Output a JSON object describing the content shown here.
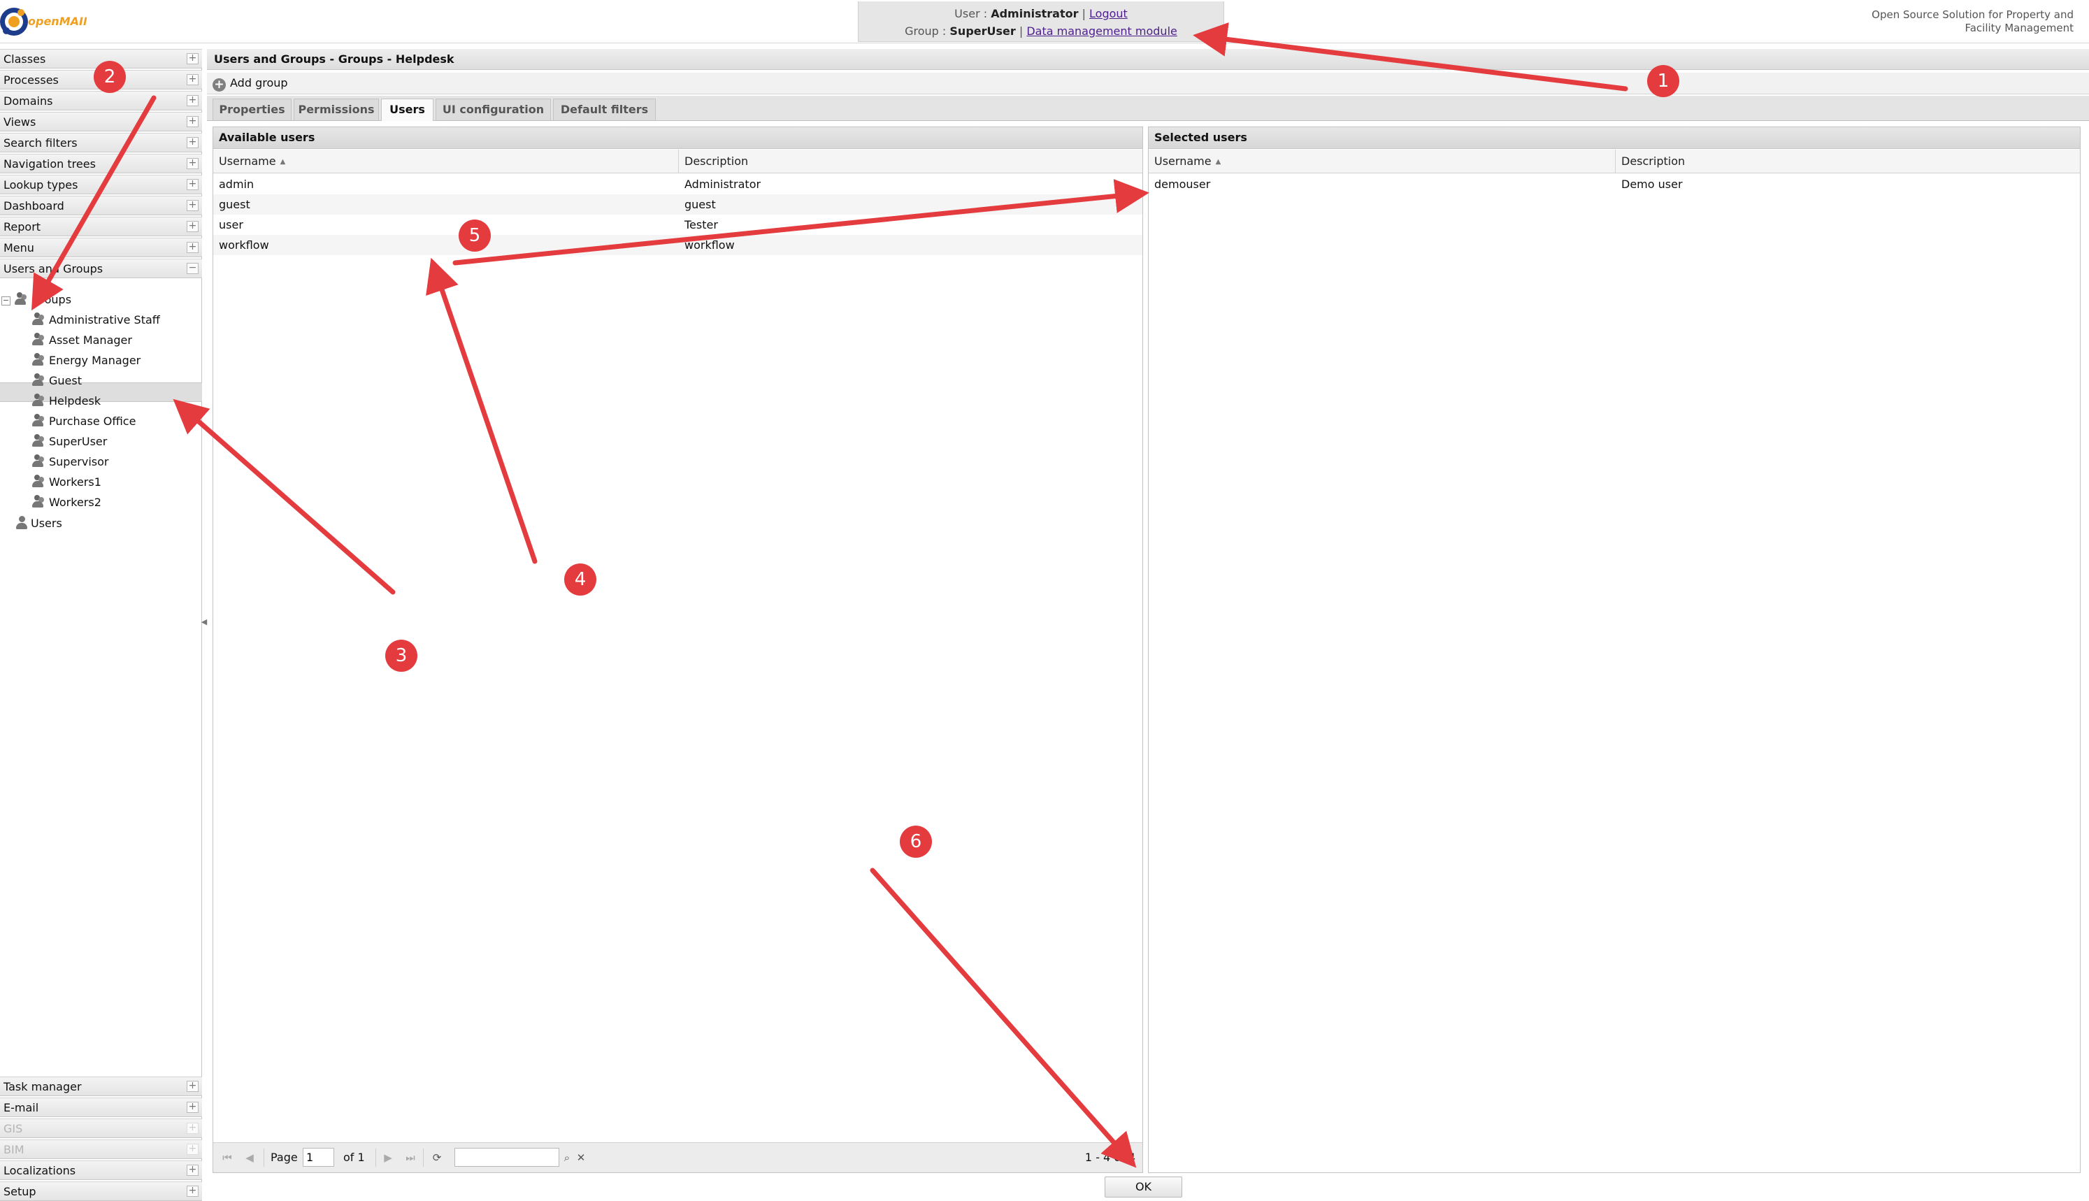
{
  "header": {
    "logo_text": "openMAINT",
    "user_label": "User :",
    "user_name": "Administrator",
    "logout": "Logout",
    "group_label": "Group :",
    "group_name": "SuperUser",
    "data_module": "Data management module",
    "tagline_1": "Open Source Solution for Property and",
    "tagline_2": "Facility Management"
  },
  "sidebar": {
    "top_sections": [
      "Classes",
      "Processes",
      "Domains",
      "Views",
      "Search filters",
      "Navigation trees",
      "Lookup types",
      "Dashboard",
      "Report",
      "Menu"
    ],
    "users_groups": "Users and Groups",
    "tree_groups": "Groups",
    "groups": [
      "Administrative Staff",
      "Asset Manager",
      "Energy Manager",
      "Guest",
      "Helpdesk",
      "Purchase Office",
      "SuperUser",
      "Supervisor",
      "Workers1",
      "Workers2"
    ],
    "tree_users": "Users",
    "bottom_sections": [
      "Task manager",
      "E-mail",
      "GIS",
      "BIM",
      "Localizations",
      "Setup"
    ]
  },
  "main": {
    "breadcrumb": "Users and Groups - Groups - Helpdesk",
    "add_group": "Add group",
    "tabs": [
      "Properties",
      "Permissions",
      "Users",
      "UI configuration",
      "Default filters"
    ],
    "active_tab": "Users"
  },
  "available": {
    "title": "Available users",
    "col_username": "Username",
    "col_description": "Description",
    "rows": [
      {
        "username": "admin",
        "description": "Administrator"
      },
      {
        "username": "guest",
        "description": "guest"
      },
      {
        "username": "user",
        "description": "Tester"
      },
      {
        "username": "workflow",
        "description": "workflow"
      }
    ]
  },
  "selected": {
    "title": "Selected users",
    "col_username": "Username",
    "col_description": "Description",
    "rows": [
      {
        "username": "demouser",
        "description": "Demo user"
      }
    ]
  },
  "pager": {
    "page_label": "Page",
    "page_value": "1",
    "of_label": "of 1",
    "display": "1 - 4 of 4"
  },
  "ok_label": "OK",
  "annotations": [
    "1",
    "2",
    "3",
    "4",
    "5",
    "6"
  ],
  "colors": {
    "annotation": "#e43b3f",
    "link": "#4d1f8c",
    "logo_orange": "#f0a020",
    "logo_blue": "#1e3c8c"
  }
}
